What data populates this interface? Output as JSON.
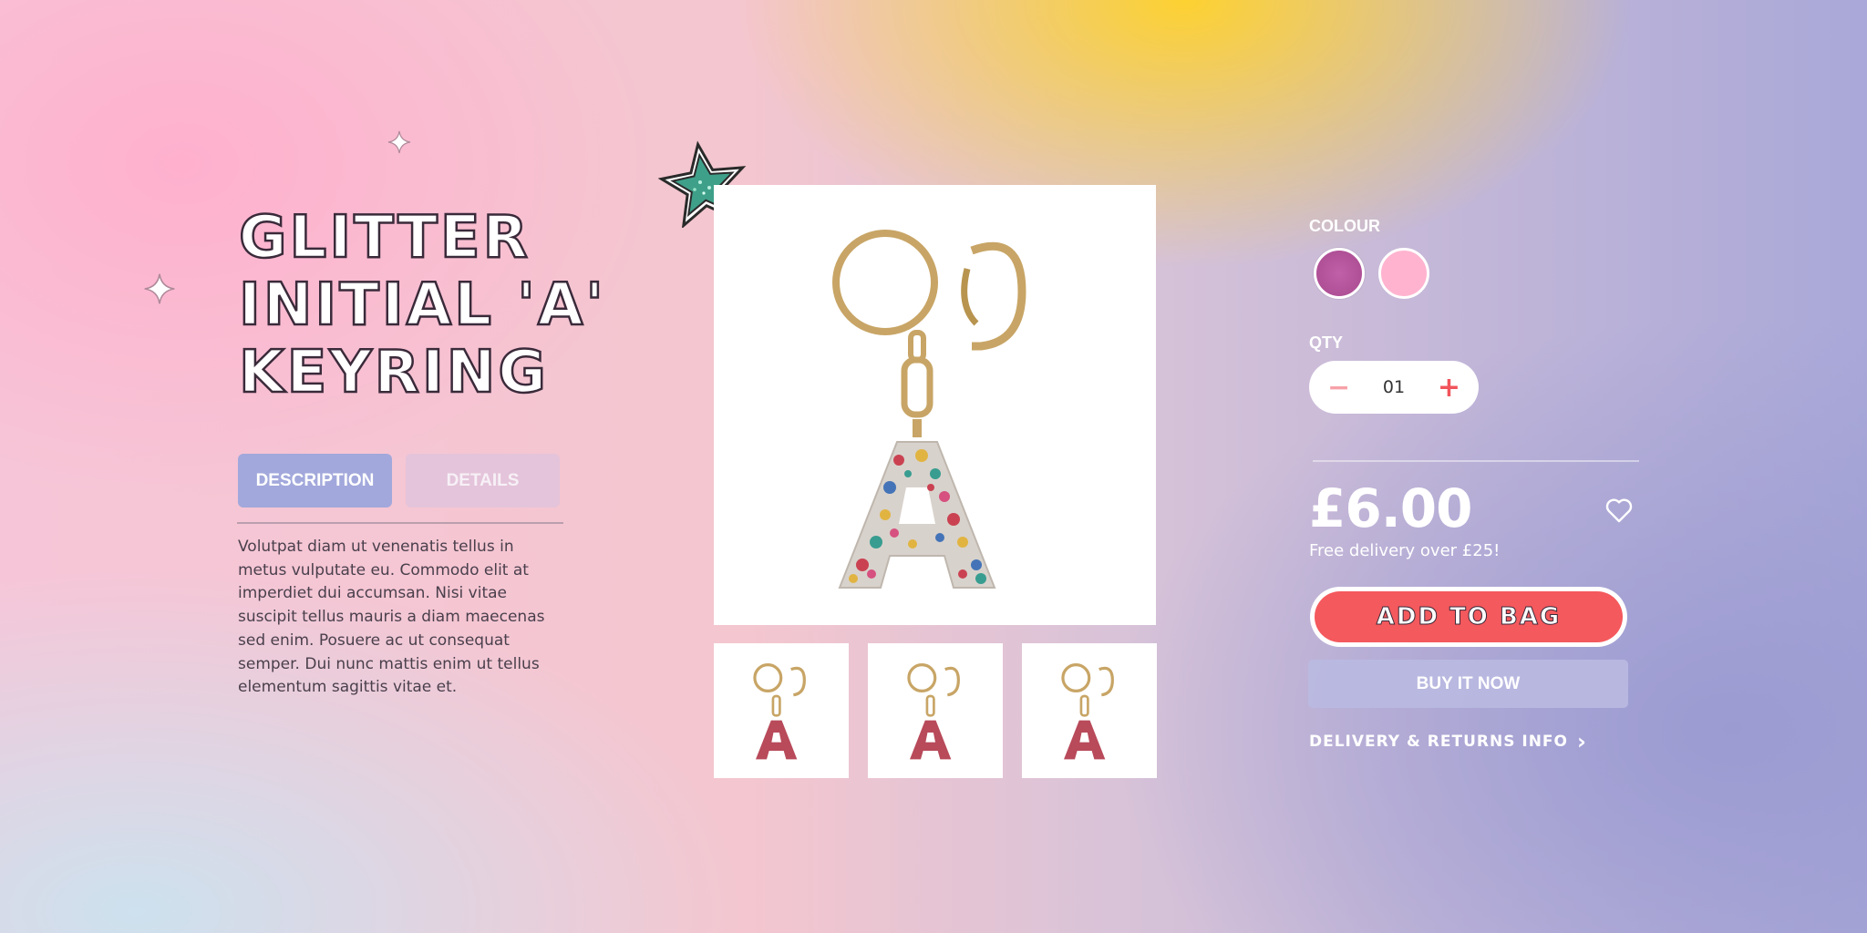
{
  "product": {
    "title": "Glitter\ninitial 'A'\nkeyring",
    "description": "Volutpat diam ut venenatis tellus in metus vulputate eu. Commodo elit at imperdiet dui accumsan. Nisi vitae suscipit tellus mauris a diam maecenas sed enim. Posuere ac ut consequat semper. Dui nunc mattis enim ut tellus elementum sagittis vitae et."
  },
  "tabs": [
    {
      "label": "DESCRIPTION",
      "active": true
    },
    {
      "label": "DETAILS",
      "active": false
    }
  ],
  "colour": {
    "label": "COLOUR",
    "options": [
      {
        "name": "glitter-purple",
        "color": "#b45aa0"
      },
      {
        "name": "pink",
        "color": "#ffb3cf"
      }
    ]
  },
  "qty": {
    "label": "QTY",
    "value": "01",
    "minus": "−",
    "plus": "+"
  },
  "price": "£6.00",
  "free_delivery": "Free delivery over £25!",
  "buttons": {
    "add_to_bag": "ADD TO BAG",
    "buy_now": "BUY IT NOW",
    "delivery": "DELIVERY & RETURNS INFO",
    "delivery_chevron": "›"
  },
  "icons": {
    "wishlist": "heart-icon",
    "sparkle": "sparkle-icon",
    "sticker": "star-sticker"
  },
  "colors": {
    "accent_red": "#f4595d",
    "tab_active": "#a2a8db"
  }
}
